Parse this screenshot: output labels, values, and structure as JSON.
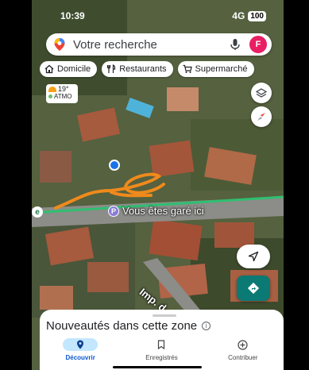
{
  "status": {
    "time": "10:39",
    "network": "4G",
    "battery": "100"
  },
  "search": {
    "placeholder": "Votre recherche",
    "avatar_letter": "F"
  },
  "chips": [
    {
      "label": "Domicile",
      "icon": "home-icon"
    },
    {
      "label": "Restaurants",
      "icon": "fork-knife-icon"
    },
    {
      "label": "Supermarché",
      "icon": "cart-icon"
    }
  ],
  "weather": {
    "temp": "19°",
    "aqi": "ATMO"
  },
  "map": {
    "parking_label": "Vous êtes garé ici",
    "parking_badge": "P",
    "road_badge": "e",
    "street_label": "Imp. d"
  },
  "sheet": {
    "title": "Nouveautés dans cette zone",
    "info": "i"
  },
  "nav": [
    {
      "label": "Découvrir",
      "icon": "explore-pin-icon",
      "active": true
    },
    {
      "label": "Enregistrés",
      "icon": "bookmark-icon",
      "active": false
    },
    {
      "label": "Contribuer",
      "icon": "add-circle-icon",
      "active": false
    }
  ],
  "colors": {
    "accent": "#0b57d0",
    "directions": "#0b7a74",
    "avatar": "#e91e63",
    "route_line": "#2fbf71",
    "drawing": "#f08a1c"
  }
}
